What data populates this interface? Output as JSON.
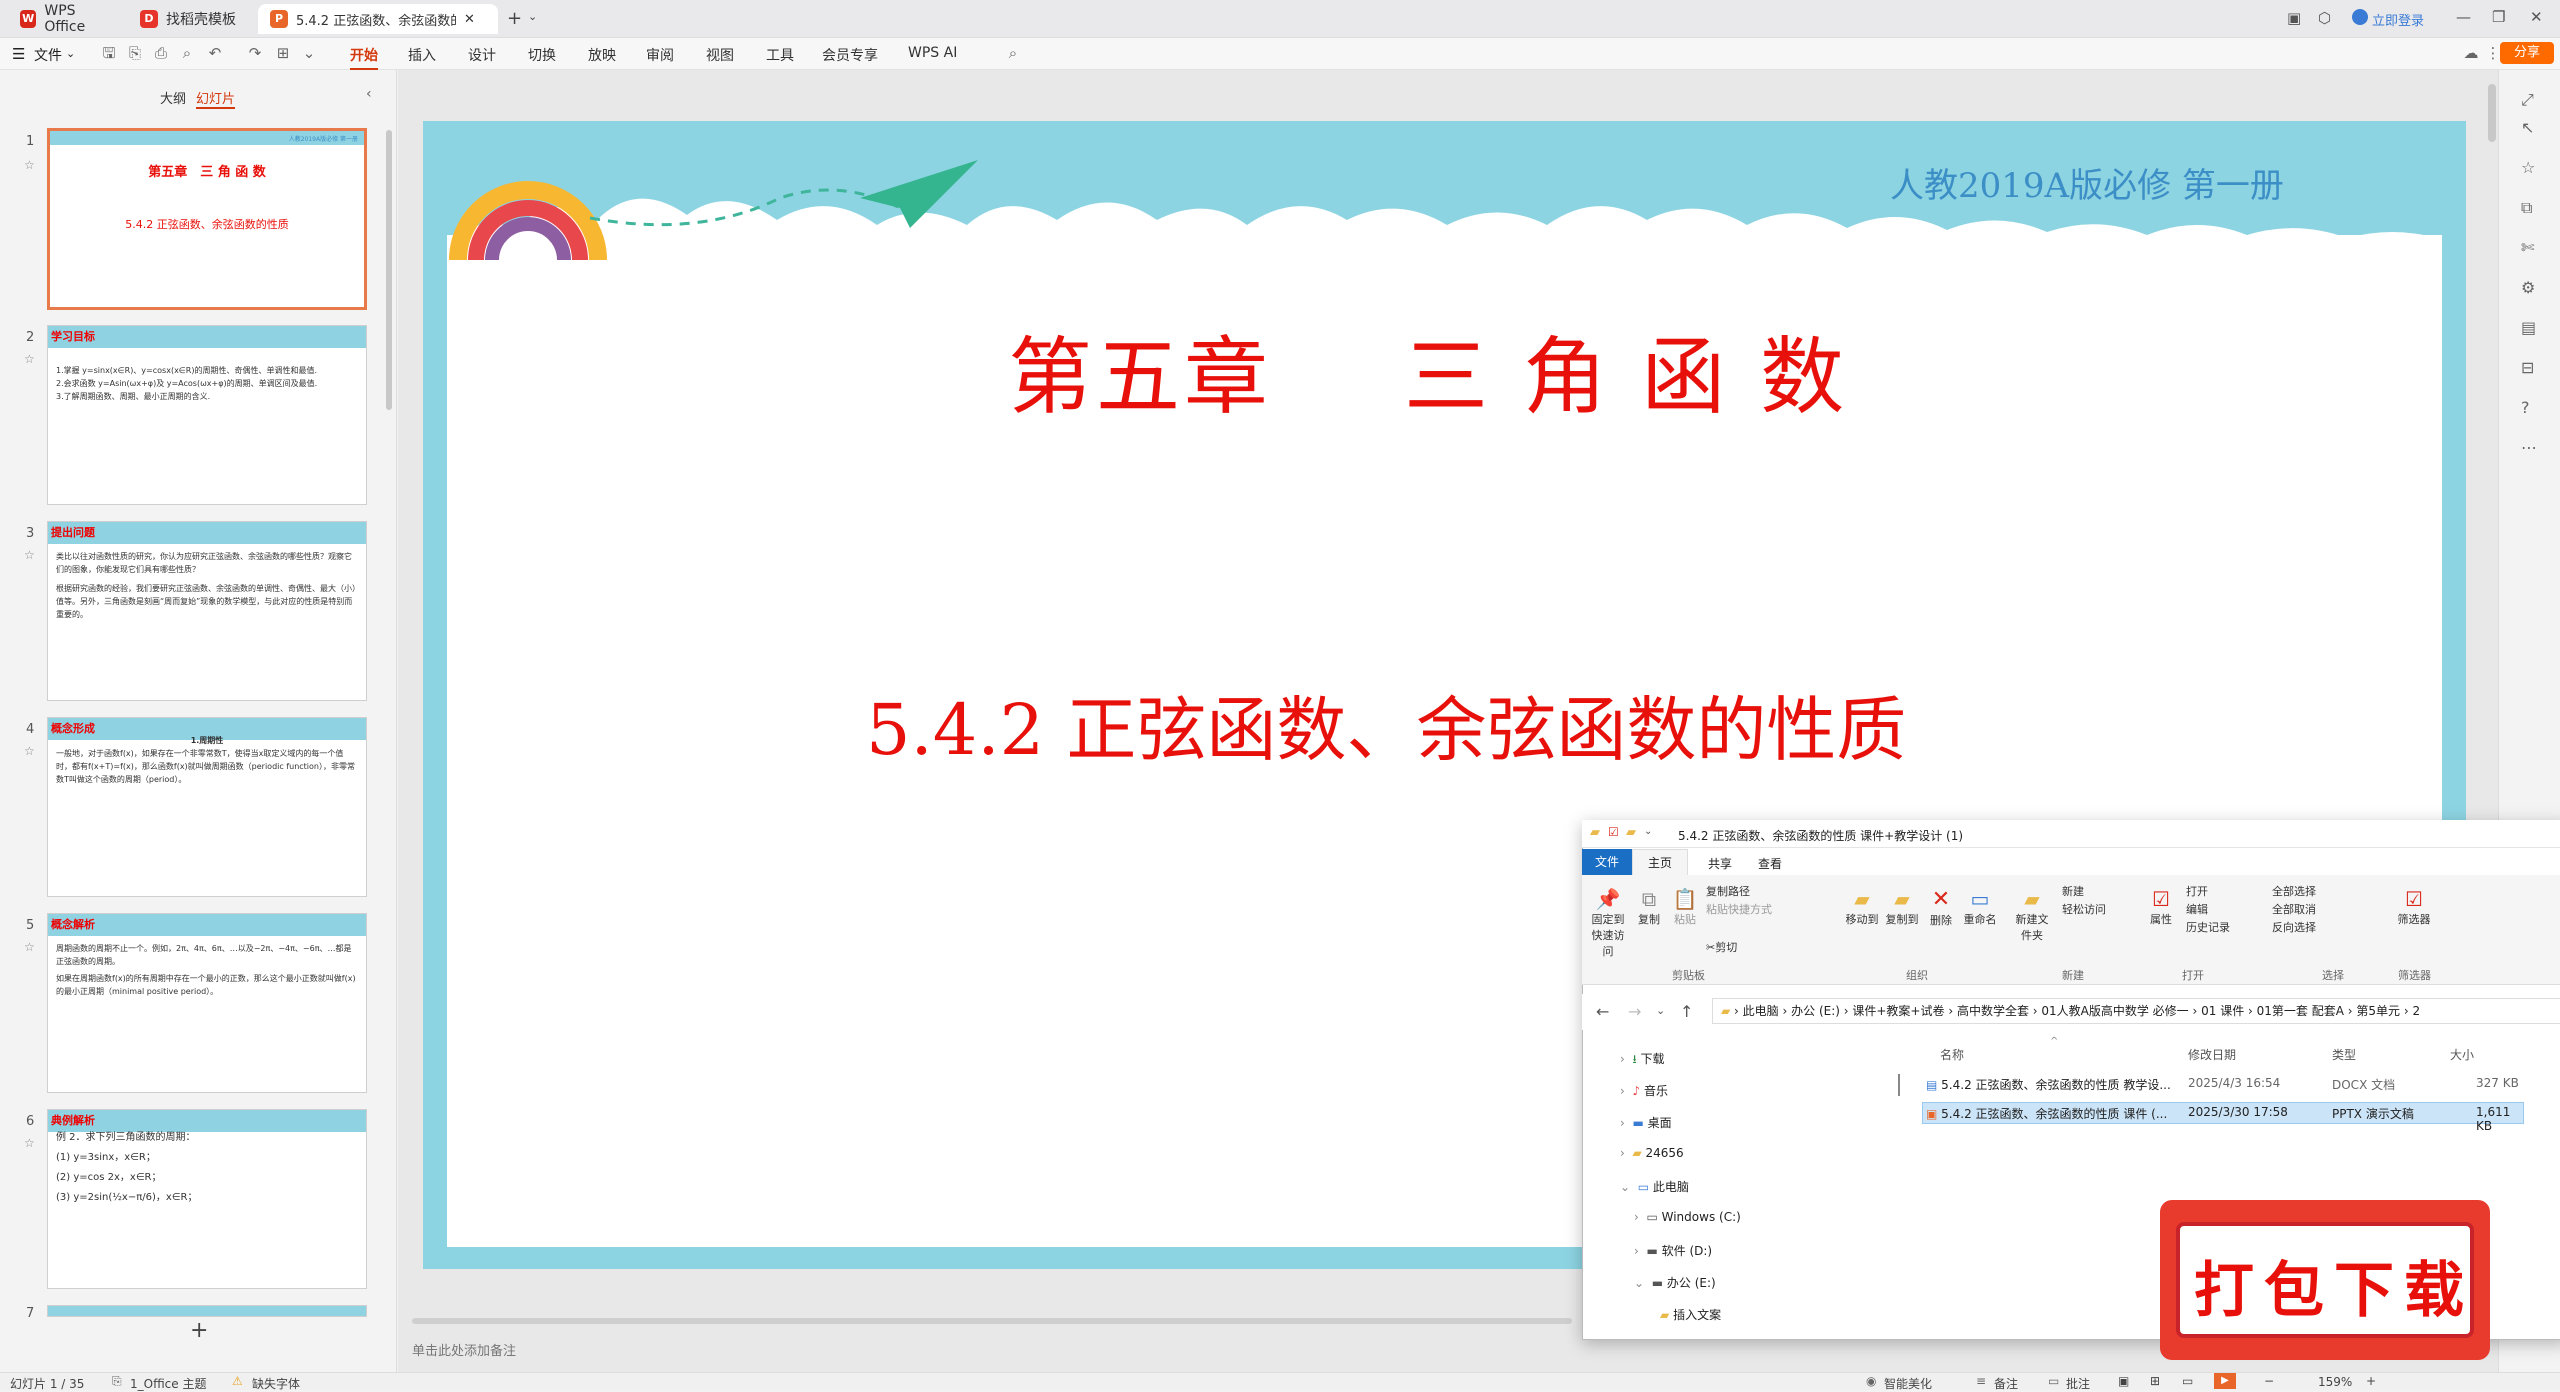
{
  "tabs": [
    {
      "label": "WPS Office",
      "icon": "wps-logo-icon"
    },
    {
      "label": "找稻壳模板",
      "icon": "daoke-icon"
    },
    {
      "label": "5.4.2 正弦函数、余弦函数的",
      "icon": "pptx-file-icon"
    }
  ],
  "window": {
    "login_label": "立即登录"
  },
  "menu": {
    "file_label": "文件",
    "items": [
      "开始",
      "插入",
      "设计",
      "切换",
      "放映",
      "审阅",
      "视图",
      "工具",
      "会员专享",
      "WPS AI"
    ],
    "share_label": "分享"
  },
  "left_panel": {
    "tab_outline": "大纲",
    "tab_slides": "幻灯片",
    "thumbnails": [
      {
        "num": "1",
        "title": "第五章　三 角 函 数",
        "subtitle": "5.4.2 正弦函数、余弦函数的性质",
        "tag": "人教2019A版必修 第一册"
      },
      {
        "num": "2",
        "tag": "学习目标",
        "lines": [
          "1.掌握 y=sinx(x∈R)、y=cosx(x∈R)的周期性、奇偶性、单调性和最值.",
          "2.会求函数 y=Asin(ωx+φ)及 y=Acos(ωx+φ)的周期、单调区间及最值.",
          "3.了解周期函数、周期、最小正周期的含义."
        ]
      },
      {
        "num": "3",
        "tag": "提出问题",
        "lines": [
          "类比以往对函数性质的研究，你认为应研究正弦函数、余弦函数的哪些性质？观察它们的图象，你能发现它们具有哪些性质？",
          "根据研究函数的经验，我们要研究正弦函数、余弦函数的单调性、奇偶性、最大（小）值等。另外，三角函数是刻画“周而复始”现象的数学模型，与此对应的性质是特别而重要的。"
        ]
      },
      {
        "num": "4",
        "tag": "概念形成",
        "lines": [
          "1.周期性",
          "一般地，对于函数f(x)，如果存在一个非零常数T，使得当x取定义域内的每一个值时，都有f(x+T)=f(x)，那么函数f(x)就叫做周期函数（periodic function），非零常数T叫做这个函数的周期（period）。"
        ]
      },
      {
        "num": "5",
        "tag": "概念解析",
        "lines": [
          "周期函数的周期不止一个。例如，2π、4π、6π、…以及−2π、−4π、−6π、…都是正弦函数的周期。",
          "如果在周期函数f(x)的所有周期中存在一个最小的正数，那么这个最小正数就叫做f(x)的最小正周期（minimal positive period）。"
        ]
      },
      {
        "num": "6",
        "tag": "典例解析",
        "lines": [
          "例 2．求下列三角函数的周期：",
          "(1) y=3sinx，x∈R；",
          "(2) y=cos 2x，x∈R；",
          "(3) y=2sin(½x−π/6)，x∈R；"
        ]
      }
    ],
    "partial_num": "7",
    "add_label": "+"
  },
  "slide": {
    "header": "人教2019A版必修 第一册",
    "chapter": "第五章",
    "chapter_title": "三 角 函 数",
    "title": "5.4.2 正弦函数、余弦函数的性质"
  },
  "notes_placeholder": "单击此处添加备注",
  "status": {
    "slide_pos": "幻灯片 1 / 35",
    "theme": "1_Office 主题",
    "missing_font": "缺失字体",
    "beautify": "智能美化",
    "notes": "备注",
    "comments": "批注",
    "zoom": "159%"
  },
  "explorer": {
    "title": "5.4.2 正弦函数、余弦函数的性质 课件+教学设计 (1)",
    "ribbon_tabs": [
      "文件",
      "主页",
      "共享",
      "查看"
    ],
    "groups": [
      {
        "name": "剪贴板",
        "buttons": [
          "固定到快速访问",
          "复制",
          "粘贴",
          "复制路径",
          "粘贴快捷方式",
          "剪切"
        ]
      },
      {
        "name": "组织",
        "buttons": [
          "移动到",
          "复制到",
          "删除",
          "重命名"
        ]
      },
      {
        "name": "新建",
        "buttons": [
          "新建文件夹",
          "新建",
          "轻松访问"
        ]
      },
      {
        "name": "打开",
        "buttons": [
          "属性",
          "打开",
          "编辑",
          "历史记录"
        ]
      },
      {
        "name": "选择",
        "buttons": [
          "全部选择",
          "全部取消",
          "反向选择"
        ]
      },
      {
        "name": "筛选器",
        "buttons": [
          "筛选器"
        ]
      }
    ],
    "breadcrumb": [
      "此电脑",
      "办公 (E:)",
      "课件+教案+试卷",
      "高中数学全套",
      "01人教A版高中数学 必修一",
      "01 课件",
      "01第一套 配套A",
      "第5单元",
      "2"
    ],
    "columns": [
      "名称",
      "修改日期",
      "类型",
      "大小"
    ],
    "tree": [
      "下载",
      "音乐",
      "桌面",
      "24656",
      "此电脑",
      "Windows (C:)",
      "软件 (D:)",
      "办公 (E:)",
      "插入文案"
    ],
    "files": [
      {
        "name": "5.4.2 正弦函数、余弦函数的性质 教学设...",
        "date": "2025/4/3 16:54",
        "type": "DOCX 文档",
        "size": "327 KB"
      },
      {
        "name": "5.4.2 正弦函数、余弦函数的性质 课件 (...",
        "date": "2025/3/30 17:58",
        "type": "PPTX 演示文稿",
        "size": "1,611 KB"
      }
    ]
  },
  "download_banner": "打包下载",
  "colors": {
    "accent": "#d4380d",
    "slide_bg": "#8dd4e3",
    "title_red": "#e8100a",
    "header_blue": "#3c8fc6"
  }
}
